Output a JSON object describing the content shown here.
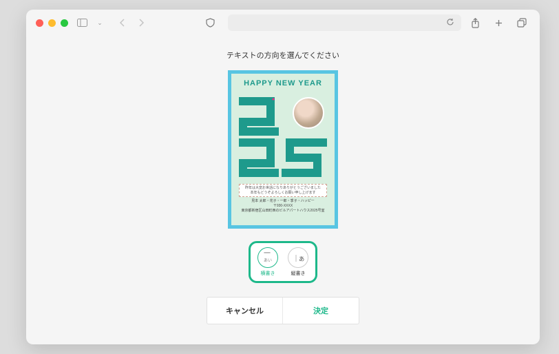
{
  "dialog": {
    "prompt": "テキストの方向を選んでください"
  },
  "card": {
    "heading": "HAPPY NEW YEAR",
    "year": "2025",
    "message_line1": "昨年は大変お世話になりありがとうございました",
    "message_line2": "本年もどうぞよろしくお願い申し上げます",
    "name_line": "見本 太郎・花子・一郎・季子・ハッピー",
    "postal_line": "〒930-XXXX",
    "address_line": "東京都新宿区山田町西のビルアパートハウス2025号室"
  },
  "choices": {
    "horizontal": {
      "label": "横書き",
      "icon_text": "一",
      "sub": "あい"
    },
    "vertical": {
      "label": "縦書き",
      "icon_text": "｜あ"
    }
  },
  "buttons": {
    "cancel": "キャンセル",
    "confirm": "決定"
  }
}
